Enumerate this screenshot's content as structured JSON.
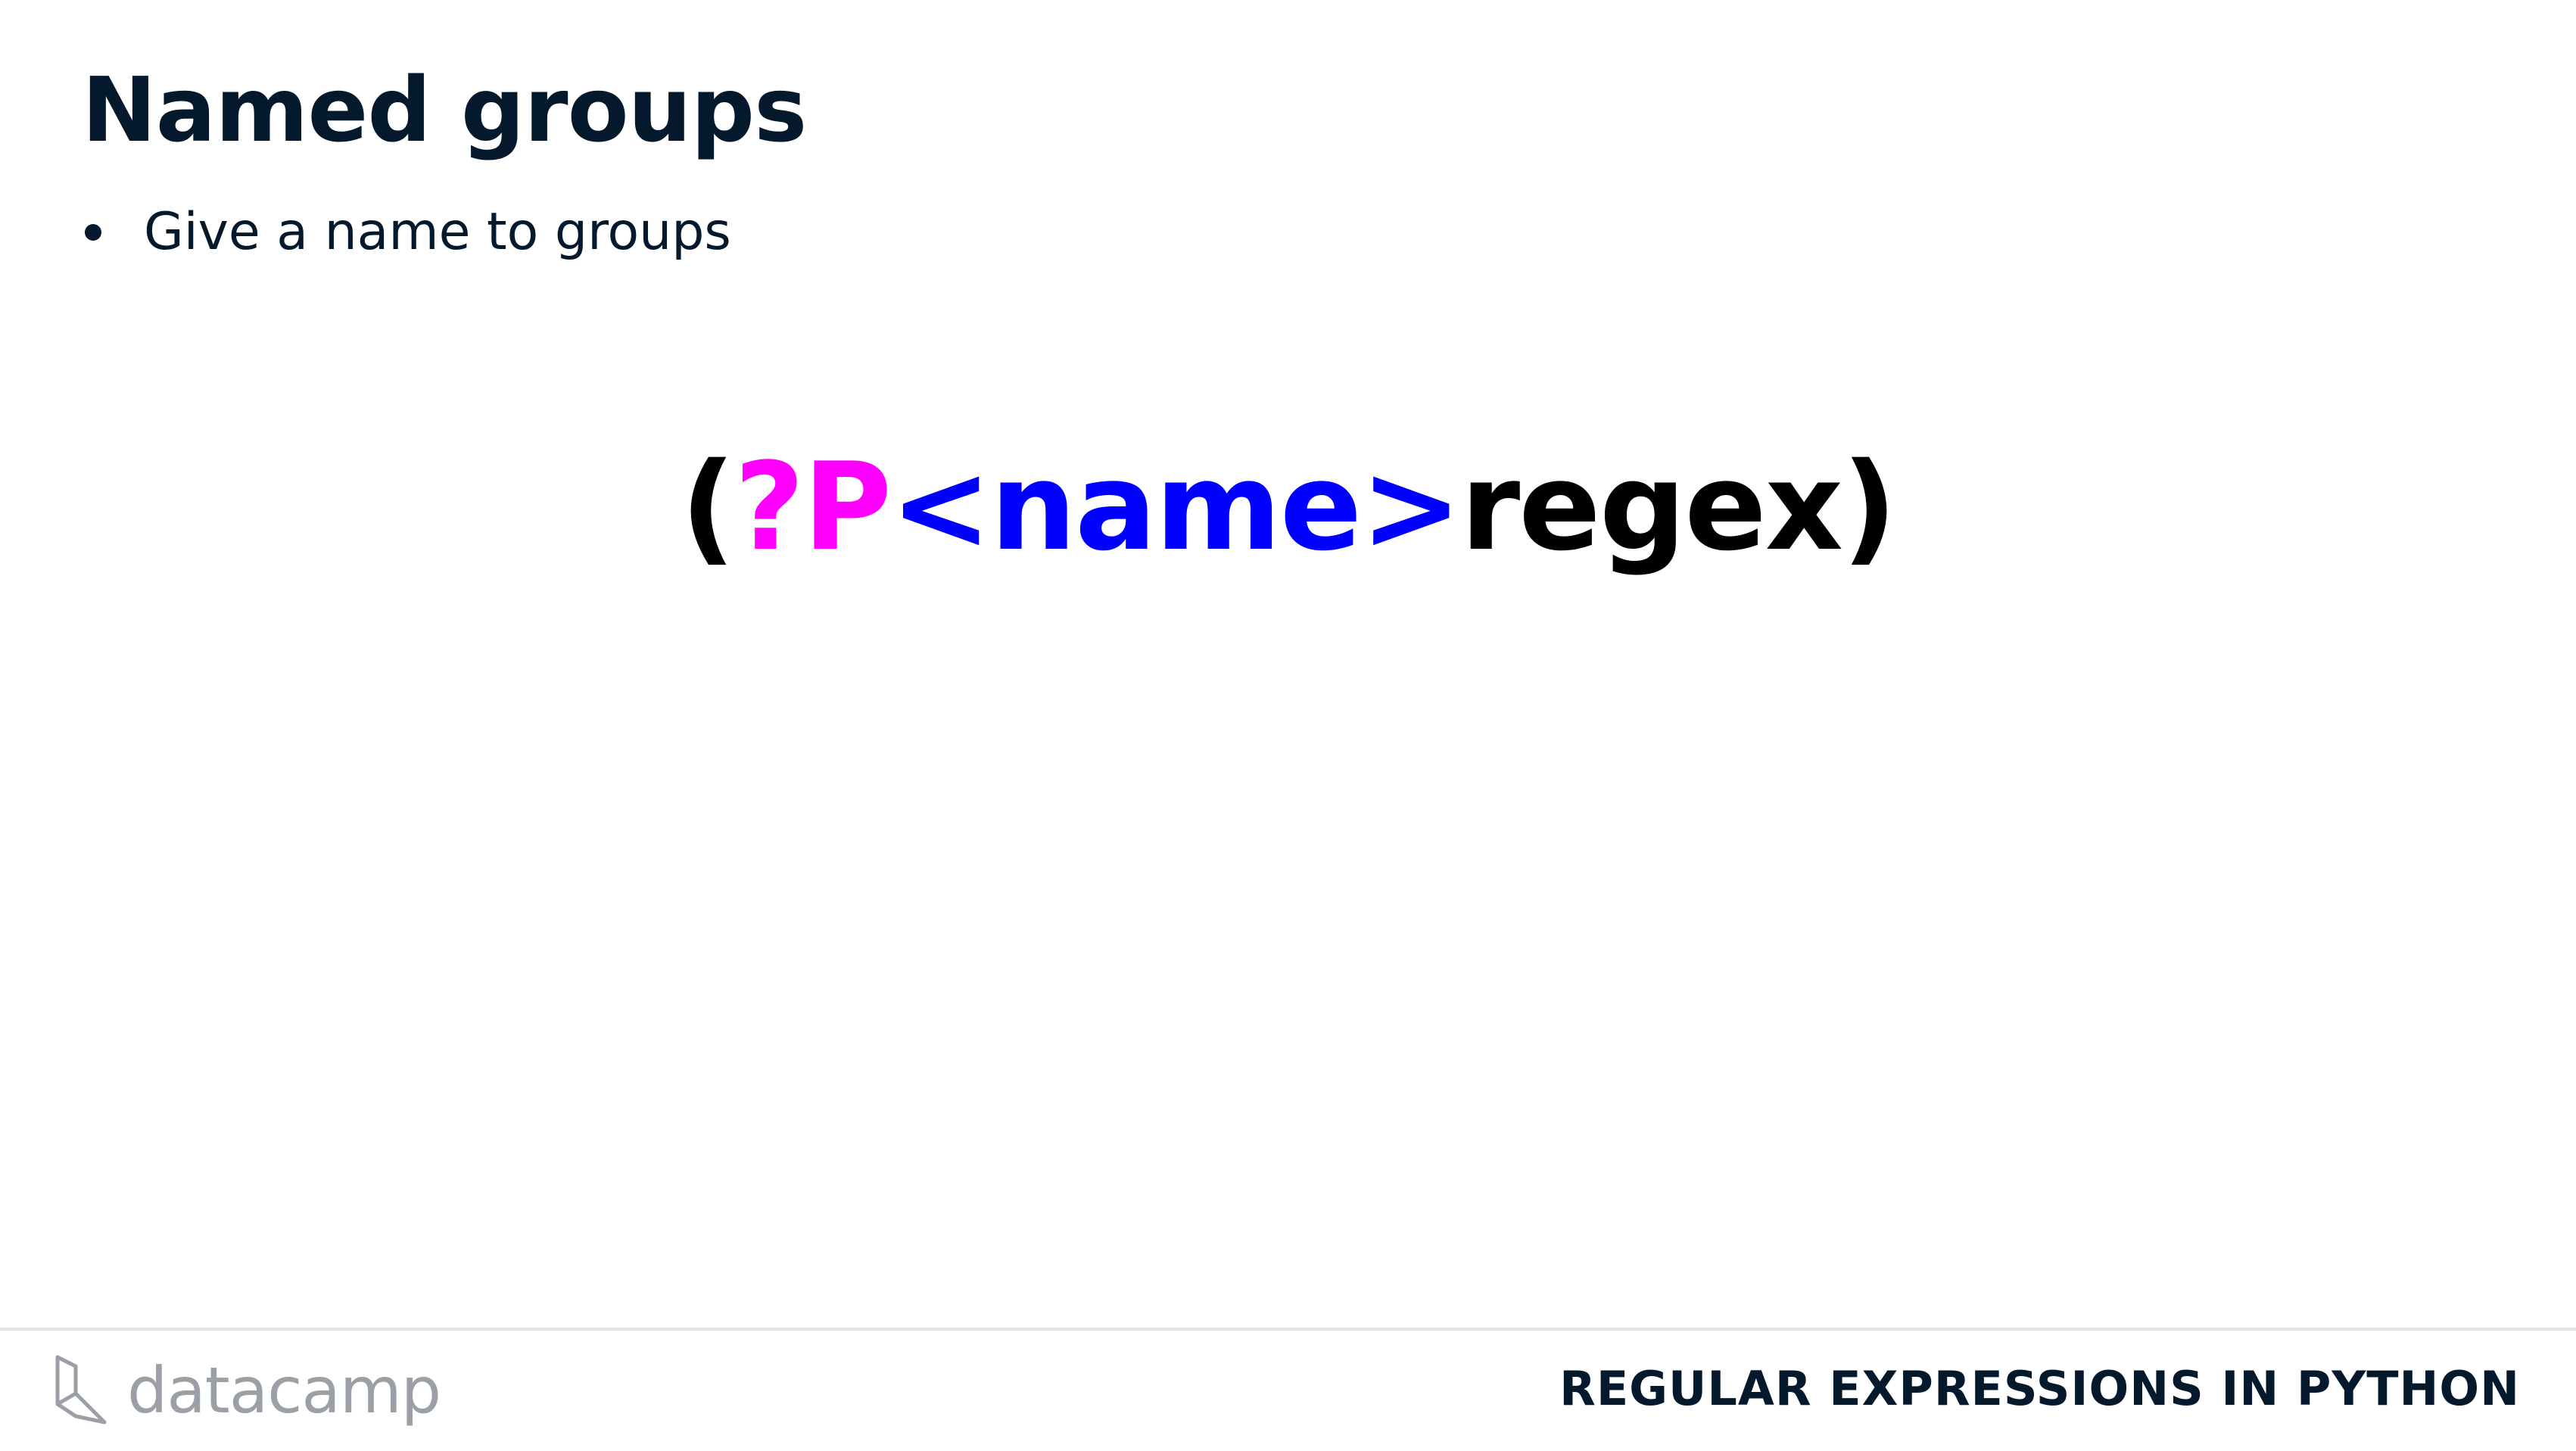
{
  "slide": {
    "title": "Named groups",
    "bullets": [
      "Give a name to groups"
    ]
  },
  "syntax": {
    "parts": [
      {
        "text": "(",
        "color": "#000000"
      },
      {
        "text": "?P",
        "color": "#ff00ff"
      },
      {
        "text": "<name>",
        "color": "#0000ff"
      },
      {
        "text": "regex)",
        "color": "#000000"
      }
    ]
  },
  "footer": {
    "logo_text": "datacamp",
    "logo_icon": "datacamp-logo-icon",
    "course_title": "REGULAR EXPRESSIONS IN PYTHON"
  },
  "colors": {
    "title": "#05192d",
    "magenta": "#ff00ff",
    "blue": "#0000ff",
    "logo_gray": "#9aa0a6",
    "divider": "#e5e5e5"
  }
}
